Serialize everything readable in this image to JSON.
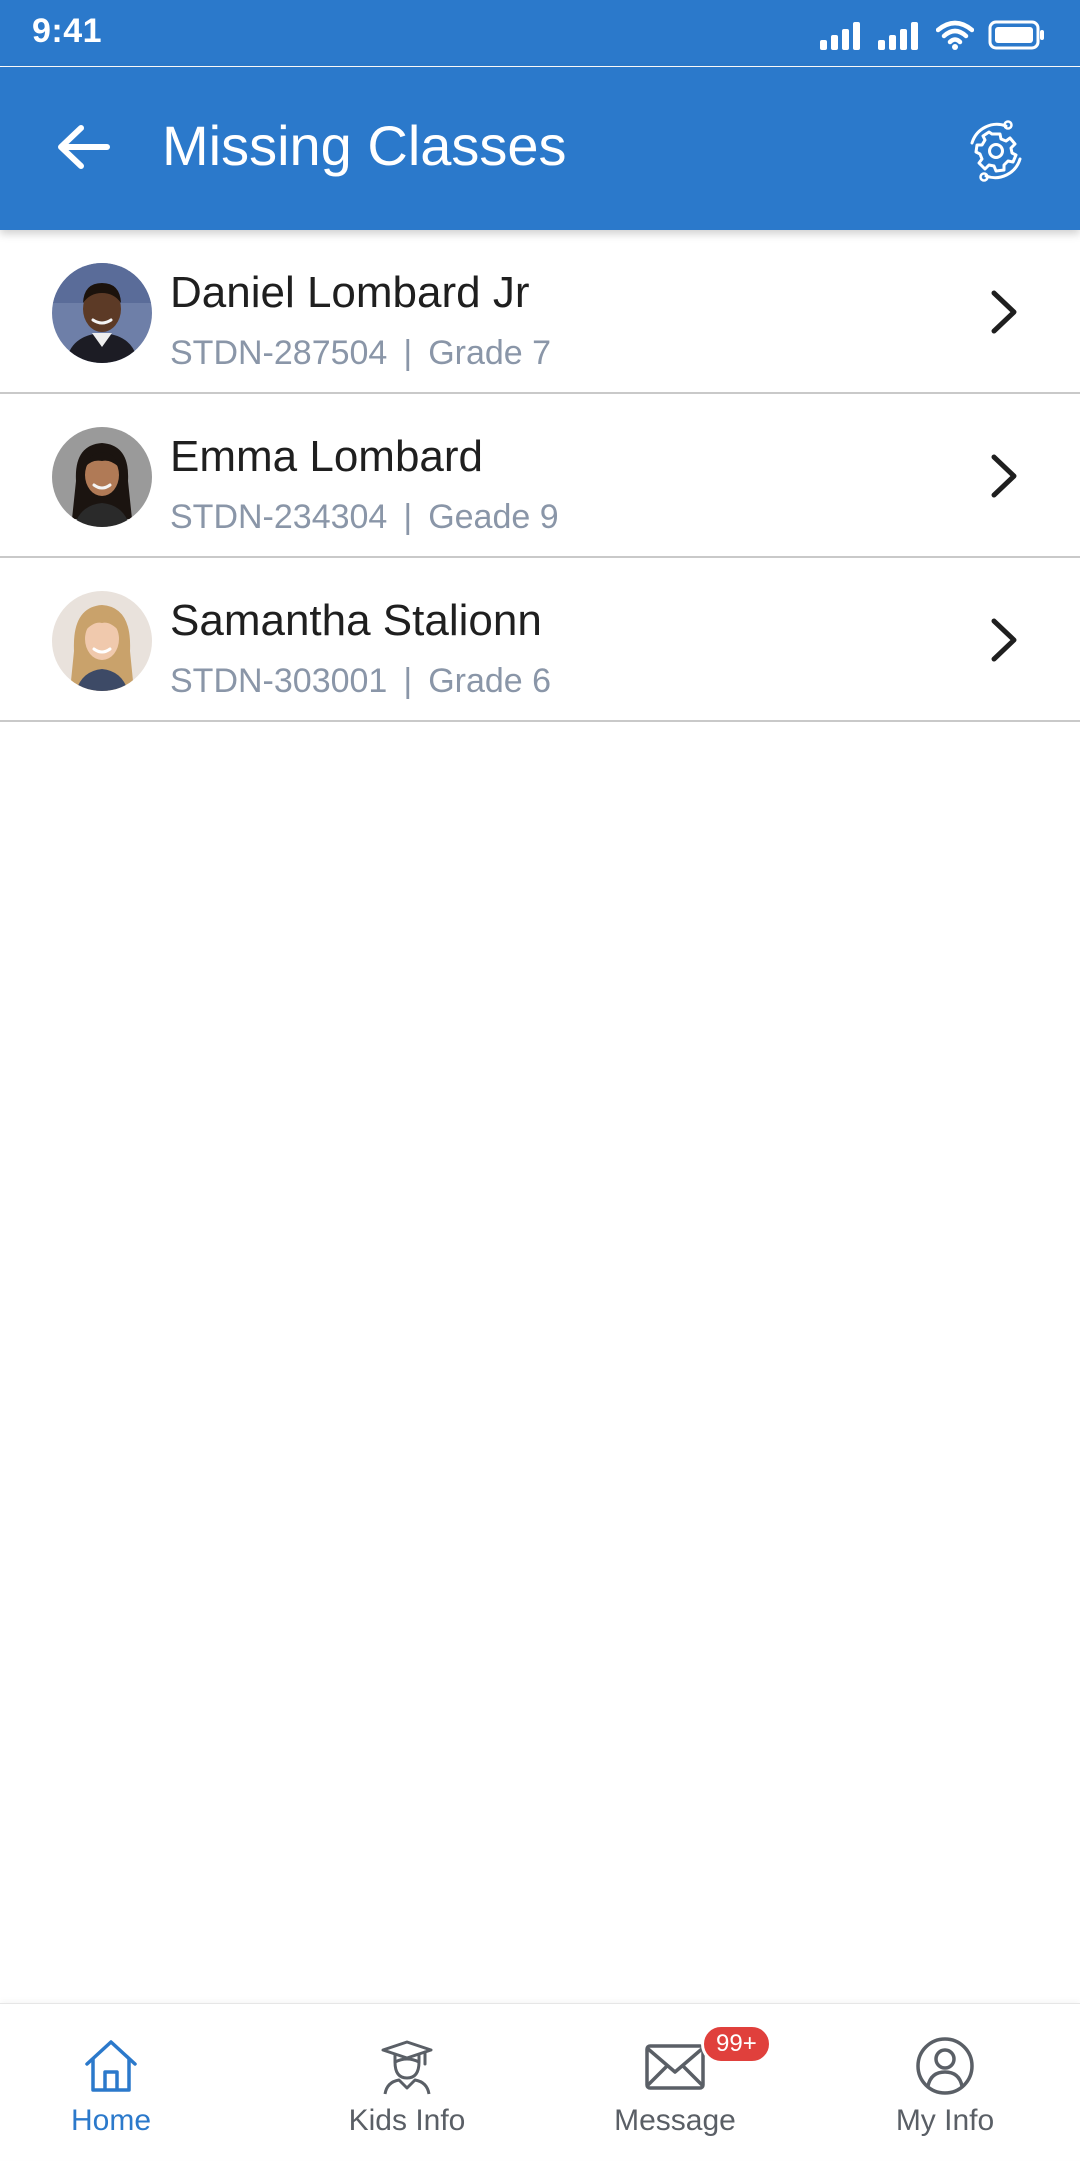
{
  "status_bar": {
    "time": "9:41"
  },
  "app_bar": {
    "title": "Missing Classes",
    "color": "#2b79cb"
  },
  "students": [
    {
      "name": "Daniel Lombard Jr",
      "id": "STDN-287504",
      "separator": "|",
      "grade": "Grade 7"
    },
    {
      "name": "Emma Lombard",
      "id": "STDN-234304",
      "separator": "|",
      "grade": "Geade 9"
    },
    {
      "name": "Samantha Stalionn",
      "id": "STDN-303001",
      "separator": "|",
      "grade": "Grade 6"
    }
  ],
  "bottom_nav": {
    "items": [
      {
        "label": "Home",
        "icon": "home-icon",
        "active": true
      },
      {
        "label": "Kids Info",
        "icon": "graduate-icon",
        "active": false
      },
      {
        "label": "Message",
        "icon": "mail-icon",
        "active": false,
        "badge": "99+"
      },
      {
        "label": "My Info",
        "icon": "user-circle-icon",
        "active": false
      }
    ],
    "active_color": "#2b79cb",
    "badge_color": "#e0403c"
  }
}
